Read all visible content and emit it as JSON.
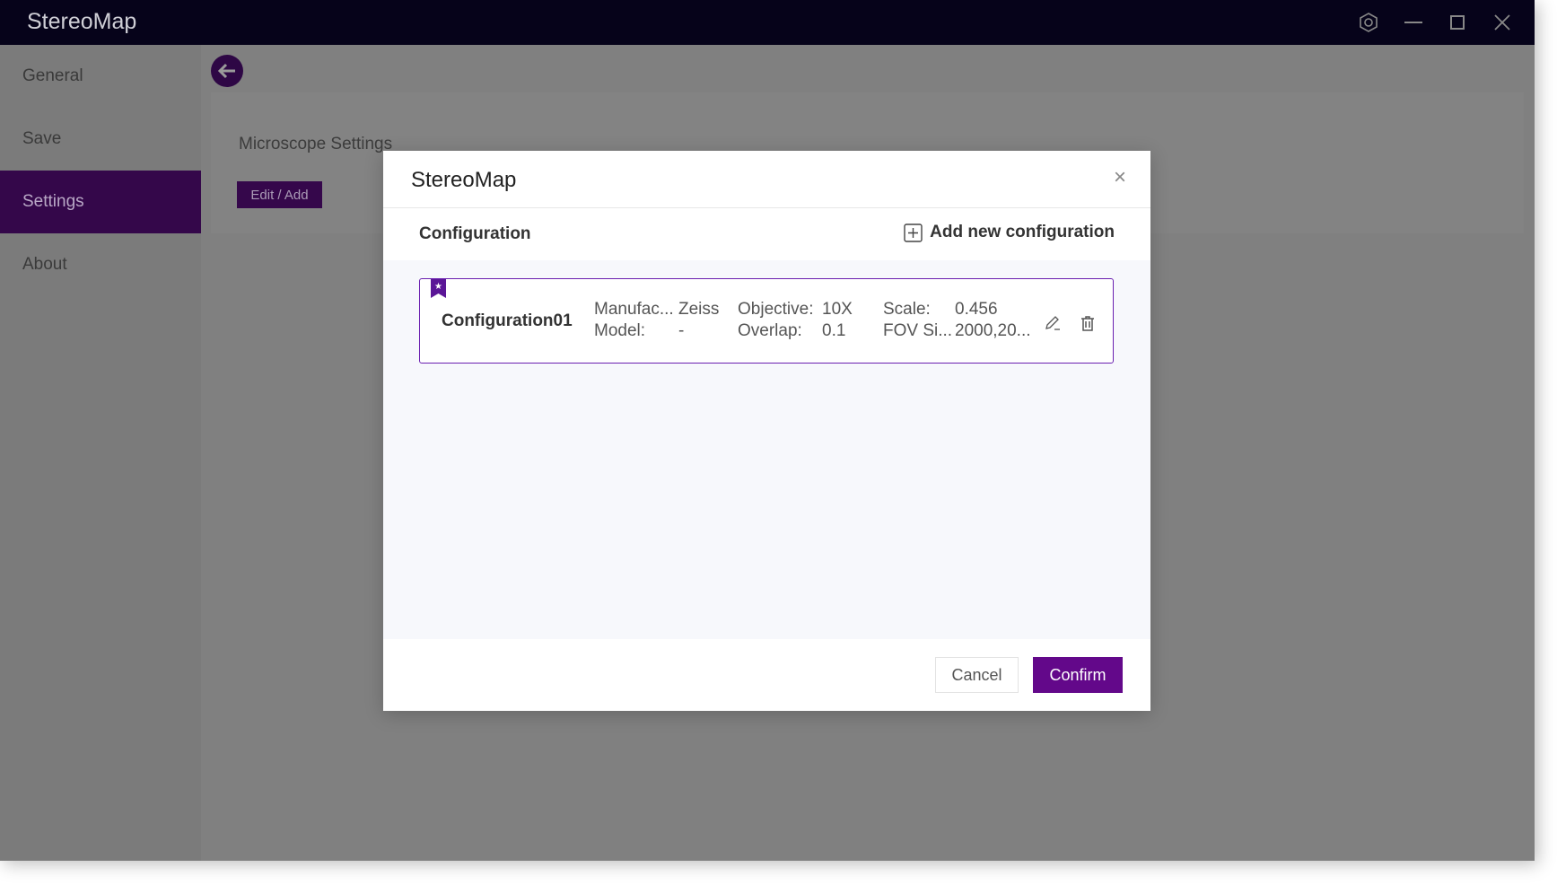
{
  "app": {
    "title": "StereoMap"
  },
  "sidebar": {
    "items": [
      {
        "label": "General"
      },
      {
        "label": "Save"
      },
      {
        "label": "Settings",
        "active": true
      },
      {
        "label": "About"
      }
    ]
  },
  "main": {
    "section_label": "Microscope Settings",
    "edit_add_label": "Edit / Add"
  },
  "modal": {
    "title": "StereoMap",
    "configuration_label": "Configuration",
    "add_new_label": "Add new configuration",
    "configurations": [
      {
        "name": "Configuration01",
        "manufacturer_label": "Manufac...",
        "manufacturer": "Zeiss",
        "model_label": "Model:",
        "model": "-",
        "objective_label": "Objective:",
        "objective": "10X",
        "overlap_label": "Overlap:",
        "overlap": "0.1",
        "scale_label": "Scale:",
        "scale": "0.456",
        "fov_label": "FOV Si...",
        "fov": "2000,20..."
      }
    ],
    "cancel_label": "Cancel",
    "confirm_label": "Confirm"
  },
  "colors": {
    "accent": "#63088a",
    "titlebar": "#06031a"
  }
}
